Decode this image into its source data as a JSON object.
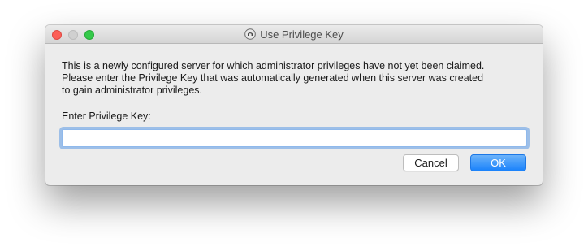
{
  "window": {
    "title": "Use Privilege Key",
    "title_icon": "teamspeak-icon"
  },
  "dialog": {
    "message_lines": [
      "This is a newly configured server for which administrator privileges have not yet been claimed.",
      "Please enter the Privilege Key that was automatically generated when this server was created",
      "to gain administrator privileges."
    ],
    "field_label": "Enter Privilege Key:",
    "key_value": "",
    "cancel_label": "Cancel",
    "ok_label": "OK"
  },
  "colors": {
    "accent": "#1a82fb",
    "close": "#fc5f57",
    "zoom": "#35c94a"
  }
}
